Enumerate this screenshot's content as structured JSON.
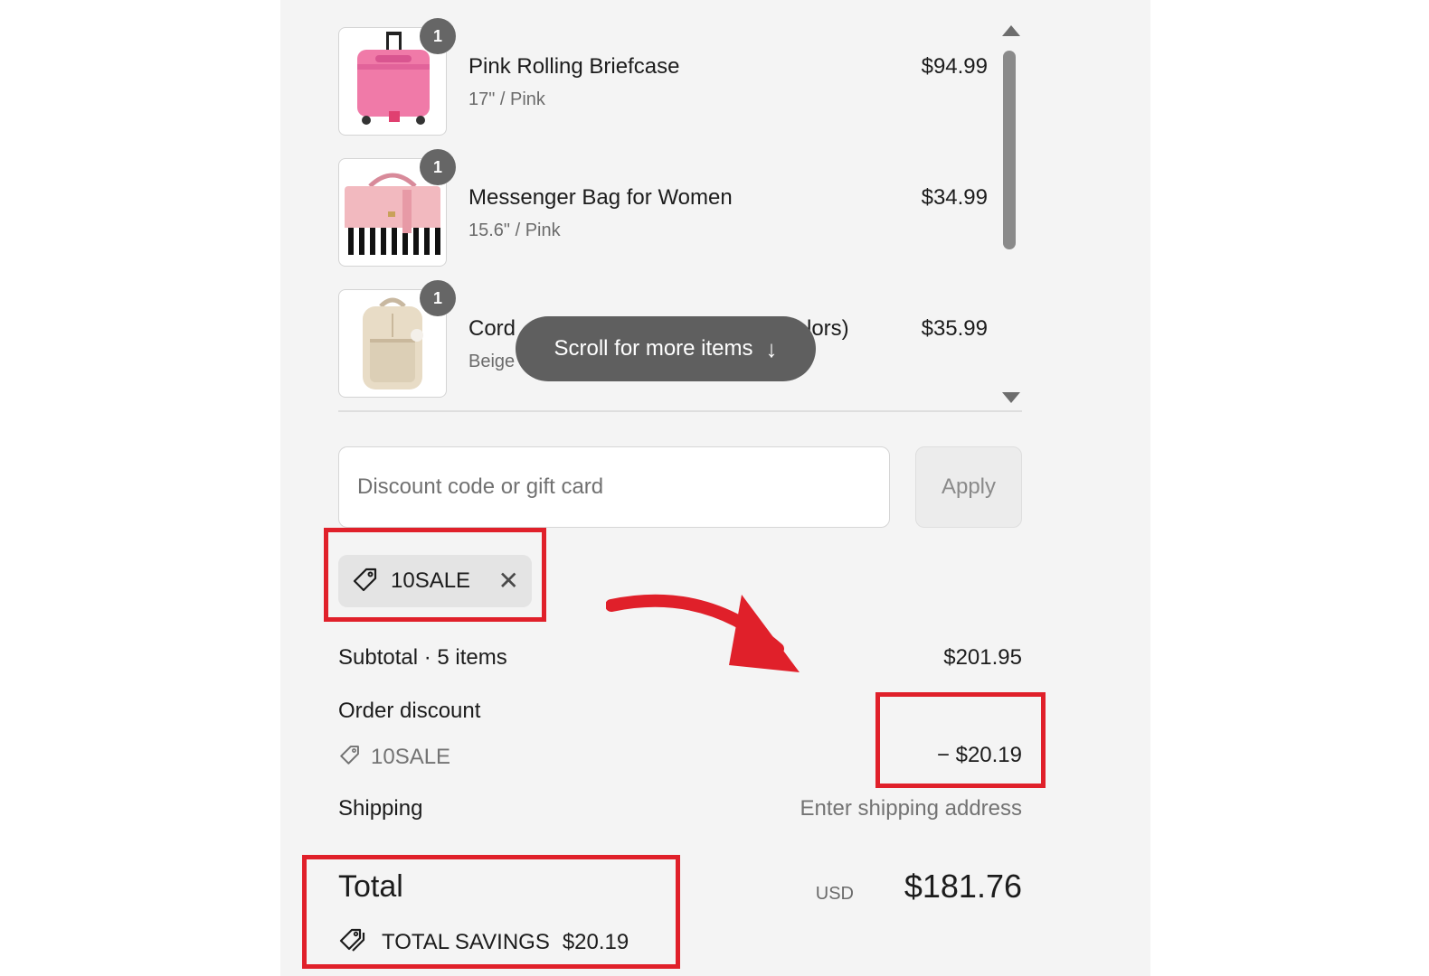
{
  "items": [
    {
      "qty": "1",
      "name": "Pink Rolling Briefcase",
      "variant": "17\" / Pink",
      "price": "$94.99"
    },
    {
      "qty": "1",
      "name": "Messenger Bag for Women",
      "variant": "15.6\" / Pink",
      "price": "$34.99"
    },
    {
      "qty": "1",
      "name": "Cord",
      "name_tail": "lors)",
      "variant": "Beige",
      "price": "$35.99"
    }
  ],
  "scroll_hint": {
    "label": "Scroll for more items",
    "icon": "arrow-down-icon"
  },
  "discount": {
    "placeholder": "Discount code or gift card",
    "apply_label": "Apply",
    "applied_code": "10SALE"
  },
  "summary": {
    "subtotal_label": "Subtotal · 5 items",
    "subtotal_value": "$201.95",
    "order_discount_label": "Order discount",
    "discount_code": "10SALE",
    "discount_value": "− $20.19",
    "shipping_label": "Shipping",
    "shipping_value": "Enter shipping address",
    "total_label": "Total",
    "currency": "USD",
    "total_value": "$181.76",
    "savings_label": "TOTAL SAVINGS",
    "savings_value": "$20.19"
  },
  "colors": {
    "annotation_red": "#e0202a",
    "panel_bg": "#f4f4f4",
    "badge_gray": "#666666"
  }
}
